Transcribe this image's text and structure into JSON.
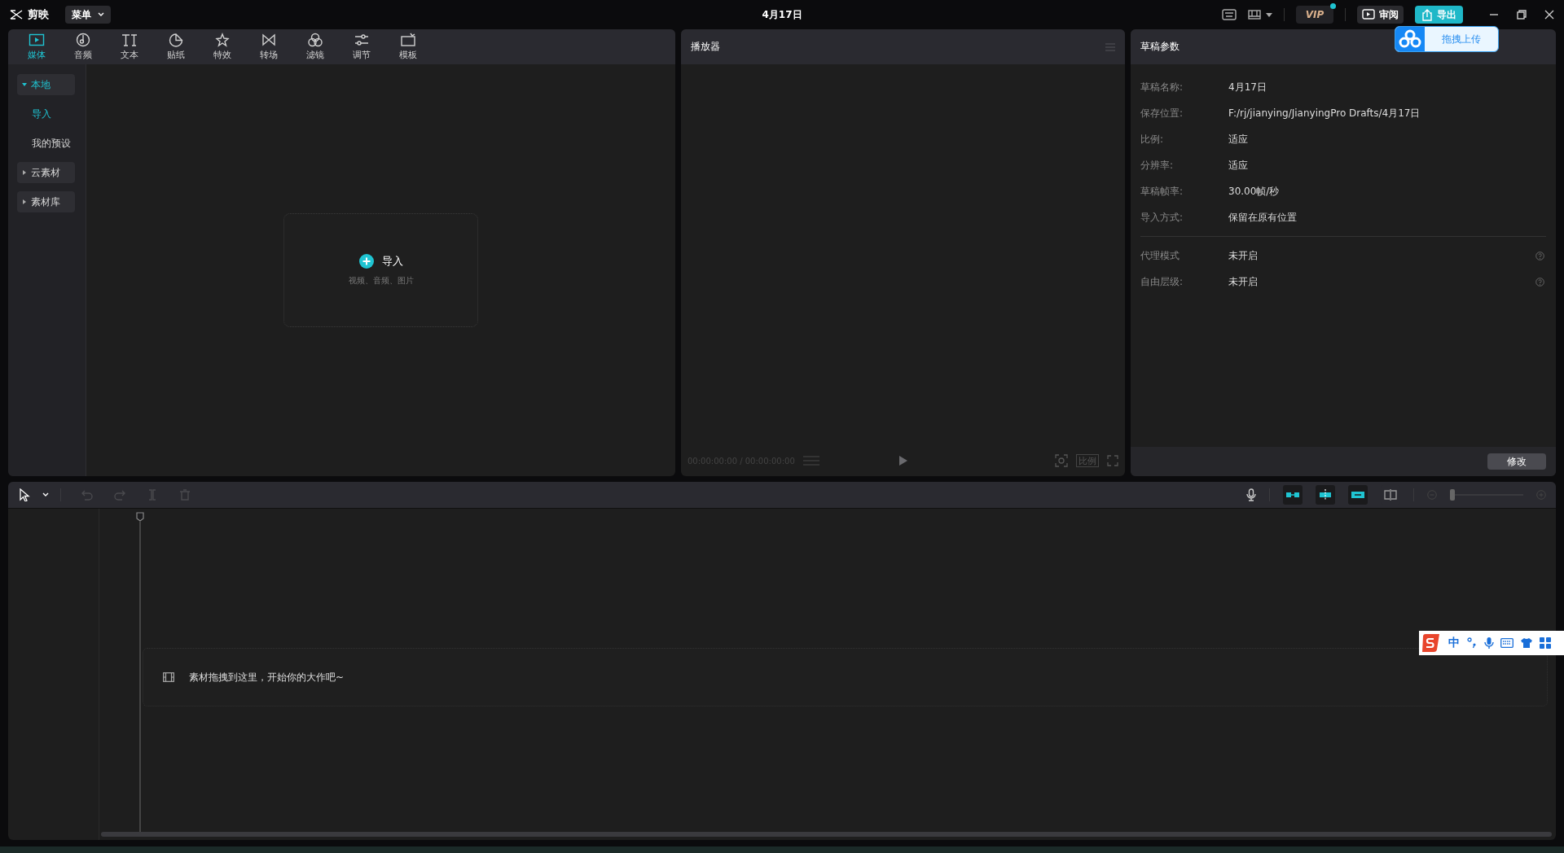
{
  "app": {
    "name": "剪映",
    "menu": "菜单",
    "title": "4月17日"
  },
  "top_actions": {
    "vip": "VIP",
    "vip_dot": true,
    "review": "审阅",
    "export": "导出"
  },
  "upload_popup": {
    "label": "拖拽上传"
  },
  "media_tabs": [
    {
      "label": "媒体",
      "kind": "media",
      "selected": true
    },
    {
      "label": "音频",
      "kind": "audio",
      "selected": false
    },
    {
      "label": "文本",
      "kind": "text",
      "selected": false
    },
    {
      "label": "贴纸",
      "kind": "sticker",
      "selected": false
    },
    {
      "label": "特效",
      "kind": "effect",
      "selected": false
    },
    {
      "label": "转场",
      "kind": "transition",
      "selected": false
    },
    {
      "label": "滤镜",
      "kind": "filter",
      "selected": false
    },
    {
      "label": "调节",
      "kind": "adjust",
      "selected": false
    },
    {
      "label": "模板",
      "kind": "template",
      "selected": false
    }
  ],
  "media_sidebar": [
    {
      "label": "本地",
      "kind": "group",
      "expanded": true,
      "selected": true
    },
    {
      "label": "导入",
      "kind": "item",
      "selected": true
    },
    {
      "label": "我的预设",
      "kind": "item",
      "selected": false
    },
    {
      "label": "云素材",
      "kind": "group",
      "expanded": false,
      "selected": false
    },
    {
      "label": "素材库",
      "kind": "group",
      "expanded": false,
      "selected": false
    }
  ],
  "import_box": {
    "label": "导入",
    "hint": "视频、音频、图片"
  },
  "player": {
    "title": "播放器",
    "timecode": "00:00:00:00 / 00:00:00:00",
    "ratio_button": "比例"
  },
  "draft_params": {
    "title": "草稿参数",
    "rows": [
      {
        "label": "草稿名称:",
        "value": "4月17日"
      },
      {
        "label": "保存位置:",
        "value": "F:/rj/jianying/JianyingPro Drafts/4月17日"
      },
      {
        "label": "比例:",
        "value": "适应"
      },
      {
        "label": "分辨率:",
        "value": "适应"
      },
      {
        "label": "草稿帧率:",
        "value": "30.00帧/秒"
      },
      {
        "label": "导入方式:",
        "value": "保留在原有位置"
      }
    ],
    "extra_rows": [
      {
        "label": "代理模式",
        "value": "未开启"
      },
      {
        "label": "自由层级:",
        "value": "未开启"
      }
    ],
    "edit_button": "修改"
  },
  "timeline": {
    "tools": [
      {
        "kind": "select",
        "disabled": false
      },
      {
        "kind": "undo",
        "disabled": true
      },
      {
        "kind": "redo",
        "disabled": true
      },
      {
        "kind": "split",
        "disabled": true
      },
      {
        "kind": "delete",
        "disabled": true
      }
    ],
    "toggles": [
      {
        "kind": "main-link",
        "on": true
      },
      {
        "kind": "snap",
        "on": true
      },
      {
        "kind": "link",
        "on": true
      },
      {
        "kind": "preview-axis",
        "on": false
      }
    ],
    "zoom_slider": {
      "level": 0
    },
    "drop_hint": "素材拖拽到这里，开始你的大作吧~"
  },
  "ime_bar": {
    "mode": "中"
  }
}
